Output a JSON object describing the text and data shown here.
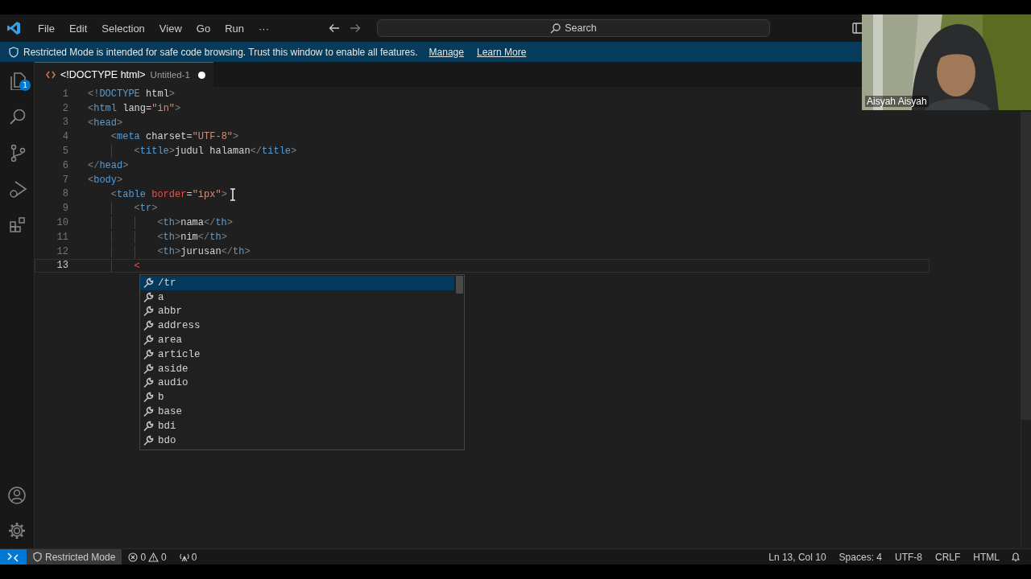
{
  "title_bar": {
    "menu": [
      "File",
      "Edit",
      "Selection",
      "View",
      "Go",
      "Run",
      "···"
    ],
    "search": {
      "placeholder": "Search"
    }
  },
  "banner": {
    "message": "Restricted Mode is intended for safe code browsing. Trust this window to enable all features.",
    "links": [
      "Manage",
      "Learn More"
    ]
  },
  "activity_bar": {
    "items": [
      {
        "kind": "files",
        "badge": "1",
        "selected": false
      },
      {
        "kind": "search",
        "selected": false
      },
      {
        "kind": "source-control",
        "selected": false
      },
      {
        "kind": "run",
        "selected": false
      },
      {
        "kind": "extensions",
        "selected": false
      }
    ],
    "bottom": [
      {
        "kind": "account"
      },
      {
        "kind": "settings"
      }
    ]
  },
  "tabs": [
    {
      "title": "<!DOCTYPE html>",
      "description": "Untitled-1",
      "modified": true,
      "selected": true
    }
  ],
  "editor": {
    "lines": [
      {
        "number": "1",
        "active": false,
        "tokens": [
          {
            "kind": "bracket",
            "text": "<!"
          },
          {
            "kind": "tag",
            "text": "DOCTYPE"
          },
          {
            "kind": "text",
            "text": " html"
          },
          {
            "kind": "bracket",
            "text": ">"
          }
        ]
      },
      {
        "number": "2",
        "active": false,
        "tokens": [
          {
            "kind": "bracket",
            "text": "<"
          },
          {
            "kind": "tag",
            "text": "html"
          },
          {
            "kind": "attr",
            "text": " lang"
          },
          {
            "kind": "text",
            "text": "="
          },
          {
            "kind": "string",
            "text": "\"in\""
          },
          {
            "kind": "bracket",
            "text": ">"
          }
        ]
      },
      {
        "number": "3",
        "active": false,
        "tokens": [
          {
            "kind": "bracket",
            "text": "<"
          },
          {
            "kind": "tag",
            "text": "head"
          },
          {
            "kind": "bracket",
            "text": ">"
          }
        ],
        "children": [
          {
            "number": "4",
            "active": false,
            "tokens": [
              {
                "kind": "bracket",
                "text": "<"
              },
              {
                "kind": "tag",
                "text": "meta"
              },
              {
                "kind": "attr",
                "text": " charset"
              },
              {
                "kind": "text",
                "text": "="
              },
              {
                "kind": "string",
                "text": "\"UTF-8\""
              },
              {
                "kind": "bracket",
                "text": ">"
              }
            ],
            "children": [
              {
                "number": "5",
                "active": false,
                "tokens": [
                  {
                    "kind": "bracket",
                    "text": "<"
                  },
                  {
                    "kind": "tag",
                    "text": "title"
                  },
                  {
                    "kind": "bracket",
                    "text": ">"
                  },
                  {
                    "kind": "text",
                    "text": "judul halaman"
                  },
                  {
                    "kind": "bracket",
                    "text": "</"
                  },
                  {
                    "kind": "tag",
                    "text": "title"
                  },
                  {
                    "kind": "bracket",
                    "text": ">"
                  }
                ]
              }
            ]
          }
        ]
      },
      {
        "number": "6",
        "active": false,
        "tokens": [
          {
            "kind": "bracket",
            "text": "</"
          },
          {
            "kind": "tag",
            "text": "head"
          },
          {
            "kind": "bracket",
            "text": ">"
          }
        ]
      },
      {
        "number": "7",
        "active": false,
        "tokens": [
          {
            "kind": "bracket",
            "text": "<"
          },
          {
            "kind": "tag",
            "text": "body"
          },
          {
            "kind": "bracket",
            "text": ">"
          }
        ],
        "children": [
          {
            "number": "8",
            "active": false,
            "tokens": [
              {
                "kind": "bracket",
                "text": "<"
              },
              {
                "kind": "tag",
                "text": "table"
              },
              {
                "kind": "error",
                "text": " border"
              },
              {
                "kind": "text",
                "text": "="
              },
              {
                "kind": "string",
                "text": "\"ipx\""
              },
              {
                "kind": "bracket",
                "text": ">"
              }
            ],
            "children": [
              {
                "number": "9",
                "active": false,
                "tokens": [
                  {
                    "kind": "bracket",
                    "text": "<"
                  },
                  {
                    "kind": "tag",
                    "text": "tr"
                  },
                  {
                    "kind": "bracket",
                    "text": ">"
                  }
                ],
                "children": [
                  {
                    "number": "10",
                    "active": false,
                    "tokens": [
                      {
                        "kind": "bracket",
                        "text": "<"
                      },
                      {
                        "kind": "tag",
                        "text": "th"
                      },
                      {
                        "kind": "bracket",
                        "text": ">"
                      },
                      {
                        "kind": "text",
                        "text": "nama"
                      },
                      {
                        "kind": "bracket",
                        "text": "</"
                      },
                      {
                        "kind": "tag",
                        "text": "th"
                      },
                      {
                        "kind": "bracket",
                        "text": ">"
                      }
                    ]
                  },
                  {
                    "number": "11",
                    "active": false,
                    "tokens": [
                      {
                        "kind": "bracket",
                        "text": "<"
                      },
                      {
                        "kind": "tag",
                        "text": "th"
                      },
                      {
                        "kind": "bracket",
                        "text": ">"
                      },
                      {
                        "kind": "text",
                        "text": "nim"
                      },
                      {
                        "kind": "bracket",
                        "text": "</"
                      },
                      {
                        "kind": "tag",
                        "text": "th"
                      },
                      {
                        "kind": "bracket",
                        "text": ">"
                      }
                    ]
                  },
                  {
                    "number": "12",
                    "active": false,
                    "tokens": [
                      {
                        "kind": "bracket",
                        "text": "<"
                      },
                      {
                        "kind": "tag",
                        "text": "th"
                      },
                      {
                        "kind": "bracket",
                        "text": ">"
                      },
                      {
                        "kind": "text",
                        "text": "jurusan"
                      },
                      {
                        "kind": "bracket",
                        "text": "</"
                      },
                      {
                        "kind": "tag",
                        "text": "th"
                      },
                      {
                        "kind": "bracket",
                        "text": ">"
                      }
                    ]
                  }
                ]
              },
              {
                "number": "13",
                "active": true,
                "tokens": [
                  {
                    "kind": "error",
                    "text": "<"
                  }
                ]
              }
            ]
          }
        ]
      }
    ],
    "suggestions": [
      {
        "label": "/tr",
        "selected": true
      },
      {
        "label": "a",
        "selected": false
      },
      {
        "label": "abbr",
        "selected": false
      },
      {
        "label": "address",
        "selected": false
      },
      {
        "label": "area",
        "selected": false
      },
      {
        "label": "article",
        "selected": false
      },
      {
        "label": "aside",
        "selected": false
      },
      {
        "label": "audio",
        "selected": false
      },
      {
        "label": "b",
        "selected": false
      },
      {
        "label": "base",
        "selected": false
      },
      {
        "label": "bdi",
        "selected": false
      },
      {
        "label": "bdo",
        "selected": false
      }
    ]
  },
  "status_bar": {
    "mode": "Restricted Mode",
    "errors": "0",
    "warnings": "0",
    "ports": "0",
    "right": [
      "Ln 13, Col 10",
      "Spaces: 4",
      "UTF-8",
      "CRLF",
      "HTML"
    ]
  },
  "video": {
    "kind": "picture",
    "name": "Aisyah Aisyah"
  }
}
